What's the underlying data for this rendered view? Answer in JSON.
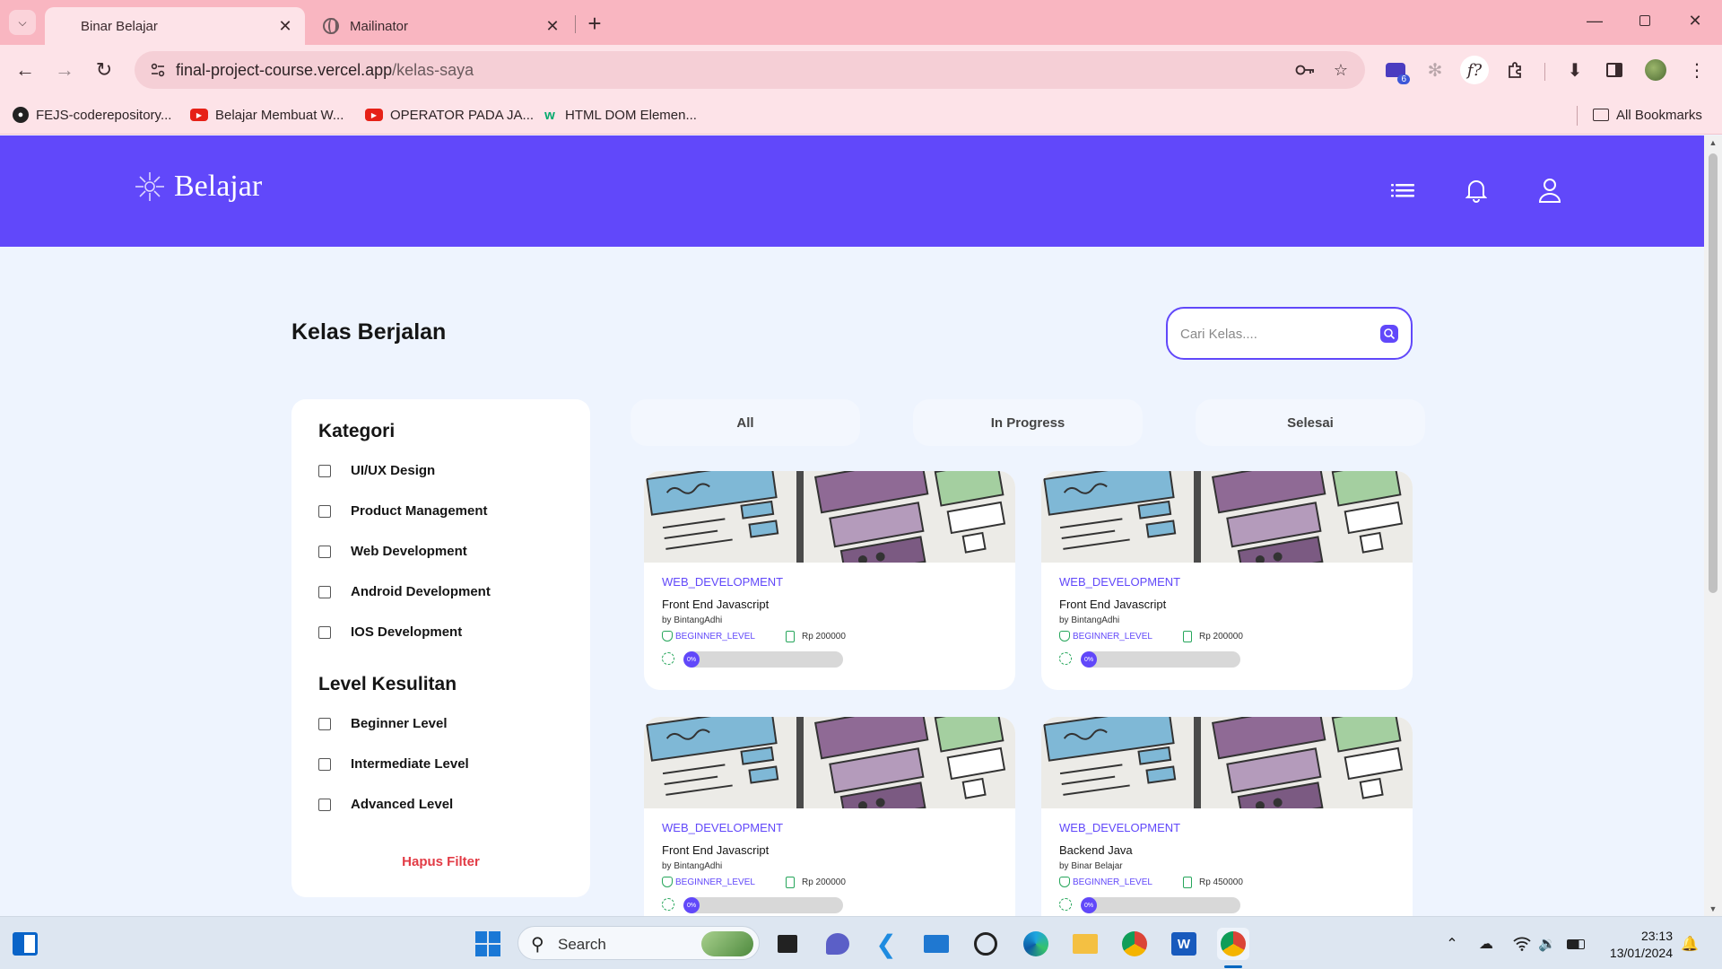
{
  "browser": {
    "tabs": [
      {
        "title": "Binar Belajar",
        "active": true
      },
      {
        "title": "Mailinator",
        "active": false
      }
    ],
    "url_host": "final-project-course.vercel.app",
    "url_path": "/kelas-saya",
    "bookmarks": [
      {
        "label": "FEJS-coderepository...",
        "icon": "github-icon"
      },
      {
        "label": "Belajar Membuat W...",
        "icon": "youtube-icon"
      },
      {
        "label": "OPERATOR PADA JA...",
        "icon": "youtube-icon"
      },
      {
        "label": "HTML DOM Elemen...",
        "icon": "w3schools-icon"
      }
    ],
    "all_bookmarks": "All Bookmarks",
    "extension_badge": "6"
  },
  "app": {
    "brand": "Belajar",
    "colors": {
      "primary": "#6148FA",
      "danger": "#E23B45",
      "success": "#26A65B"
    },
    "page_title": "Kelas Berjalan",
    "search": {
      "placeholder": "Cari Kelas....",
      "value": ""
    },
    "filter": {
      "category_title": "Kategori",
      "categories": [
        "UI/UX Design",
        "Product Management",
        "Web Development",
        "Android Development",
        "IOS Development"
      ],
      "level_title": "Level Kesulitan",
      "levels": [
        "Beginner Level",
        "Intermediate Level",
        "Advanced Level"
      ],
      "clear_label": "Hapus Filter"
    },
    "status_tabs": [
      "All",
      "In Progress",
      "Selesai"
    ],
    "courses": [
      {
        "category": "WEB_DEVELOPMENT",
        "title": "Front End Javascript",
        "author": "by BintangAdhi",
        "level": "BEGINNER_LEVEL",
        "price": "Rp 200000",
        "progress_label": "0%",
        "progress": 0
      },
      {
        "category": "WEB_DEVELOPMENT",
        "title": "Front End Javascript",
        "author": "by BintangAdhi",
        "level": "BEGINNER_LEVEL",
        "price": "Rp 200000",
        "progress_label": "0%",
        "progress": 0
      },
      {
        "category": "WEB_DEVELOPMENT",
        "title": "Front End Javascript",
        "author": "by BintangAdhi",
        "level": "BEGINNER_LEVEL",
        "price": "Rp 200000",
        "progress_label": "0%",
        "progress": 0
      },
      {
        "category": "WEB_DEVELOPMENT",
        "title": "Backend Java",
        "author": "by Binar Belajar",
        "level": "BEGINNER_LEVEL",
        "price": "Rp 450000",
        "progress_label": "0%",
        "progress": 0
      }
    ]
  },
  "taskbar": {
    "search_label": "Search",
    "time": "23:13",
    "date": "13/01/2024"
  }
}
